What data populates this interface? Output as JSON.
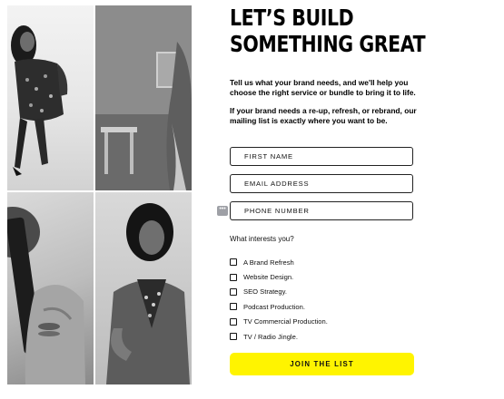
{
  "headline": "LET’S BUILD\nSOMETHING GREAT",
  "intro": {
    "line1": "Tell us what your brand needs, and we'll help you choose the right service or bundle to bring it to life.",
    "line2": "If your brand needs a re-up, refresh, or rebrand, our mailing list is exactly where you want to be."
  },
  "form": {
    "first_name_placeholder": "FIRST NAME",
    "email_placeholder": "EMAIL ADDRESS",
    "phone_placeholder": "PHONE NUMBER",
    "password_manager_icon": "•••",
    "interests_label": "What interests you?",
    "interests": [
      {
        "label": "A Brand Refresh",
        "checked": false
      },
      {
        "label": "Website Design.",
        "checked": false
      },
      {
        "label": "SEO Strategy.",
        "checked": false
      },
      {
        "label": "Podcast Production.",
        "checked": false
      },
      {
        "label": "TV Commercial Production.",
        "checked": false
      },
      {
        "label": "TV / Radio Jingle.",
        "checked": false
      }
    ],
    "submit_label": "JOIN THE LIST"
  },
  "colors": {
    "cta_background": "#fff400",
    "text": "#000000"
  }
}
